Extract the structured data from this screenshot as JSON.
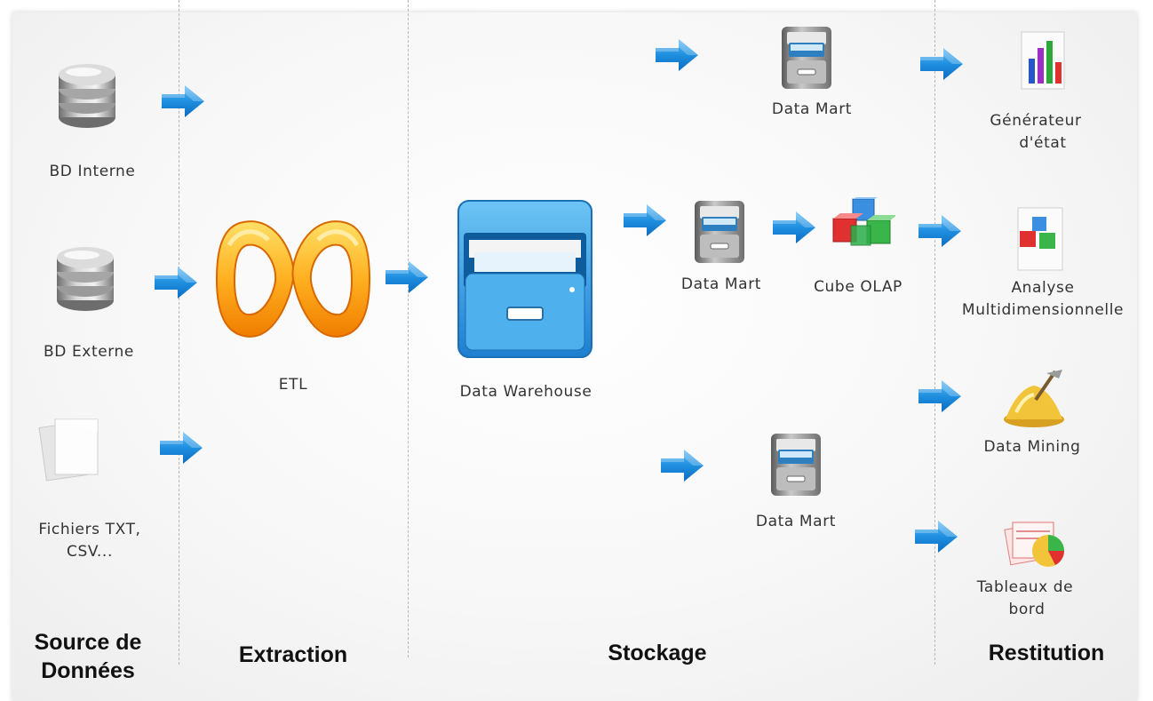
{
  "sources": {
    "bd_interne": "BD Interne",
    "bd_externe": "BD Externe",
    "fichiers_line1": "Fichiers TXT,",
    "fichiers_line2": "CSV..."
  },
  "etl": "ETL",
  "warehouse": "Data Warehouse",
  "storage": {
    "datamart_top": "Data Mart",
    "datamart_mid": "Data Mart",
    "cube": "Cube OLAP",
    "datamart_bottom": "Data Mart"
  },
  "outputs": {
    "generateur_line1": "Générateur",
    "generateur_line2": "d'état",
    "analyse_line1": "Analyse",
    "analyse_line2": "Multidimensionnelle",
    "mining": "Data Mining",
    "tableaux_line1": "Tableaux de",
    "tableaux_line2": "bord"
  },
  "columns": {
    "source_line1": "Source de",
    "source_line2": "Données",
    "extraction": "Extraction",
    "stockage": "Stockage",
    "restitution": "Restitution"
  },
  "colors": {
    "arrow": "#1f8fe0",
    "etl": "#f5a20c",
    "warehouse": "#2b97dc"
  }
}
